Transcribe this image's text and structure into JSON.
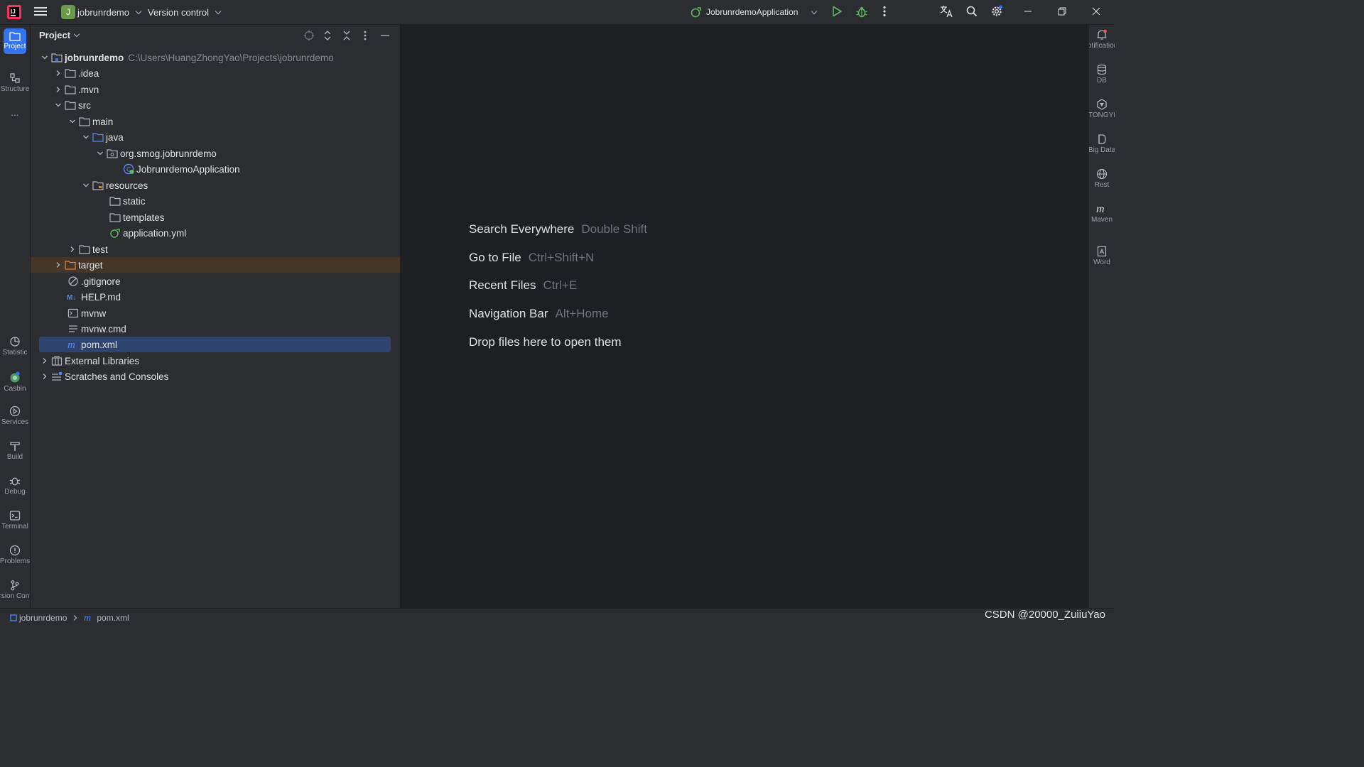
{
  "toolbar": {
    "project_letter": "J",
    "project_name": "jobrunrdemo",
    "vcs_label": "Version control",
    "run_config": "JobrunrdemoApplication"
  },
  "left_tool_windows": {
    "top": [
      {
        "label": "Project"
      },
      {
        "label": "Structure"
      },
      {
        "label": "..."
      }
    ],
    "bottom": [
      {
        "label": "Statistic"
      },
      {
        "label": "Casbin"
      },
      {
        "label": "Services"
      },
      {
        "label": "Build"
      },
      {
        "label": "Debug"
      },
      {
        "label": "Terminal"
      },
      {
        "label": "Problems"
      },
      {
        "label": "Version Control"
      }
    ]
  },
  "right_tool_windows": [
    {
      "label": "Notifications"
    },
    {
      "label": "DB"
    },
    {
      "label": "TONGYI"
    },
    {
      "label": "Big Data"
    },
    {
      "label": "Rest"
    },
    {
      "label": "Maven"
    },
    {
      "label": "Word"
    }
  ],
  "panel": {
    "title": "Project"
  },
  "tree": [
    {
      "label": "jobrunrdemo",
      "path": "C:\\Users\\HuangZhongYao\\Projects\\jobrunrdemo",
      "bold": true
    },
    {
      "label": ".idea"
    },
    {
      "label": ".mvn"
    },
    {
      "label": "src"
    },
    {
      "label": "main"
    },
    {
      "label": "java"
    },
    {
      "label": "org.smog.jobrunrdemo"
    },
    {
      "label": "JobrunrdemoApplication"
    },
    {
      "label": "resources"
    },
    {
      "label": "static"
    },
    {
      "label": "templates"
    },
    {
      "label": "application.yml"
    },
    {
      "label": "test"
    },
    {
      "label": "target"
    },
    {
      "label": ".gitignore"
    },
    {
      "label": "HELP.md"
    },
    {
      "label": "mvnw"
    },
    {
      "label": "mvnw.cmd"
    },
    {
      "label": "pom.xml"
    },
    {
      "label": "External Libraries"
    },
    {
      "label": "Scratches and Consoles"
    }
  ],
  "editor_hints": [
    {
      "label": "Search Everywhere",
      "shortcut": "Double Shift"
    },
    {
      "label": "Go to File",
      "shortcut": "Ctrl+Shift+N"
    },
    {
      "label": "Recent Files",
      "shortcut": "Ctrl+E"
    },
    {
      "label": "Navigation Bar",
      "shortcut": "Alt+Home"
    },
    {
      "label": "Drop files here to open them",
      "shortcut": ""
    }
  ],
  "statusbar": {
    "crumb_project": "jobrunrdemo",
    "crumb_file": "pom.xml",
    "watermark": "CSDN @20000_ZuiiuYao"
  },
  "colors": {
    "accent": "#3574f0",
    "selection": "#2e436e",
    "excluded_row": "#45362a",
    "folder_orange": "#d9873b",
    "run_green": "#5fb865"
  }
}
